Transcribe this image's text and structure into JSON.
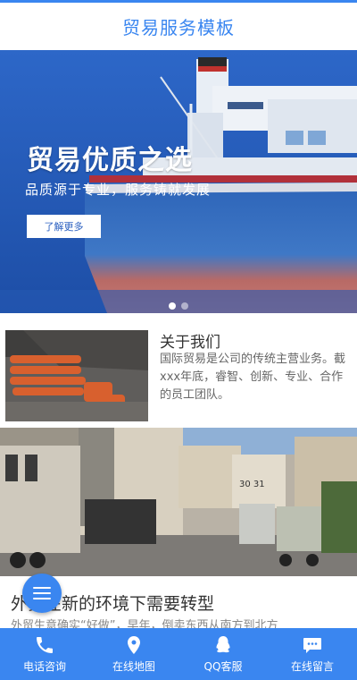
{
  "header": {
    "title": "贸易服务模板"
  },
  "hero": {
    "headline": "贸易优质之选",
    "subtitle": "品质源于专业，服务铸就发展",
    "button": "了解更多"
  },
  "about": {
    "title": "关于我们",
    "text": "国际贸易是公司的传统主营业务。截xxx年底，睿智、创新、专业、合作的员工团队。"
  },
  "news": {
    "title": "外贸在新的环境下需要转型",
    "text": "外贸生意确实“好做”，早年，倒卖东西从南方到北方"
  },
  "bottom_nav": [
    {
      "label": "电话咨询",
      "icon": "phone-icon"
    },
    {
      "label": "在线地图",
      "icon": "map-pin-icon"
    },
    {
      "label": "QQ客服",
      "icon": "qq-icon"
    },
    {
      "label": "在线留言",
      "icon": "message-icon"
    }
  ]
}
